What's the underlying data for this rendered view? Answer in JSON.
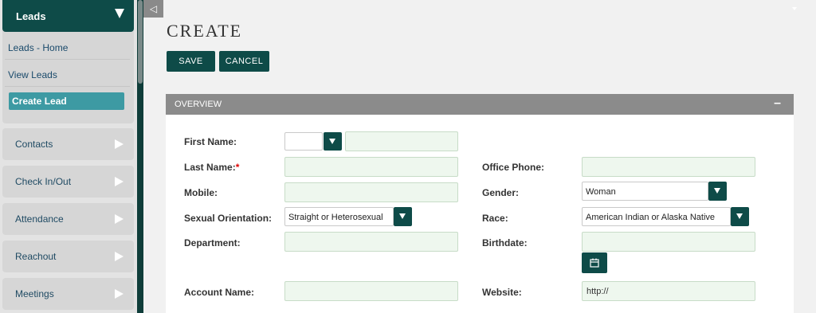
{
  "sidebar": {
    "active_module": "Leads",
    "sub_items": [
      "Leads - Home",
      "View Leads"
    ],
    "active_sub_item": "Create Lead",
    "modules": [
      "Contacts",
      "Check In/Out",
      "Attendance",
      "Reachout",
      "Meetings"
    ]
  },
  "page": {
    "title": "CREATE",
    "save_label": "SAVE",
    "cancel_label": "CANCEL",
    "panel_title": "OVERVIEW",
    "panel_toggle": "–"
  },
  "form": {
    "first_name": {
      "label": "First Name:",
      "value": ""
    },
    "last_name": {
      "label": "Last Name:",
      "required_mark": "*",
      "value": ""
    },
    "mobile": {
      "label": "Mobile:",
      "value": ""
    },
    "sexual_orientation": {
      "label": "Sexual Orientation:",
      "value": "Straight or Heterosexual"
    },
    "department": {
      "label": "Department:",
      "value": ""
    },
    "account_name": {
      "label": "Account Name:",
      "value": ""
    },
    "office_phone": {
      "label": "Office Phone:",
      "value": ""
    },
    "gender": {
      "label": "Gender:",
      "value": "Woman"
    },
    "race": {
      "label": "Race:",
      "value": "American Indian or Alaska Native"
    },
    "birthdate": {
      "label": "Birthdate:",
      "value": ""
    },
    "website": {
      "label": "Website:",
      "value": "http://"
    }
  },
  "colors": {
    "primary": "#0e4b48",
    "active_sub": "#3d9aa3",
    "panel_header": "#8b8b8b",
    "field_bg": "#eef7ee"
  },
  "icons": [
    "collapse-sidebar-icon",
    "dropdown-arrow-icon",
    "calendar-icon",
    "right-arrow-icon"
  ]
}
